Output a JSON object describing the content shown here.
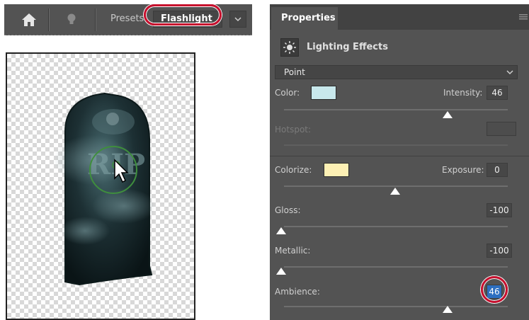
{
  "options_bar": {
    "presets_label": "Presets:",
    "preset_value": "Flashlight",
    "icons": [
      "home-icon",
      "lightbulb-icon",
      "chevron-down-icon"
    ]
  },
  "canvas": {
    "content": "tombstone-image-on-transparent-checkerboard",
    "overlay_icon": "pointer-cursor-icon"
  },
  "panel": {
    "tab_label": "Properties",
    "header_title": "Lighting Effects",
    "light_type": "Point",
    "color_label": "Color:",
    "color_swatch": "#c8e8ec",
    "intensity_label": "Intensity:",
    "intensity_value": "46",
    "hotspot_label": "Hotspot:",
    "colorize_label": "Colorize:",
    "colorize_swatch": "#fdf0b4",
    "exposure_label": "Exposure:",
    "exposure_value": "0",
    "gloss_label": "Gloss:",
    "gloss_value": "-100",
    "metallic_label": "Metallic:",
    "metallic_value": "-100",
    "ambience_label": "Ambience:",
    "ambience_value": "46"
  },
  "colors": {
    "highlight_ring": "#c8102e",
    "selection_blue": "#2d6fc0",
    "panel_bg": "#535353"
  }
}
